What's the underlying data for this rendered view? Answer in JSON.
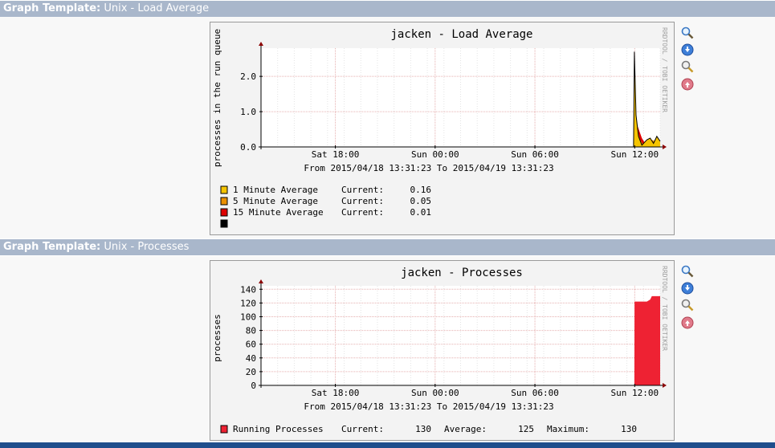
{
  "sections": [
    {
      "header_bold": "Graph Template:",
      "header_text": " Unix - Load Average",
      "graph": {
        "title": "jacken - Load Average",
        "side_text": "RRDTOOL / TOBI OETIKER",
        "date_range": "From 2015/04/18 13:31:23 To 2015/04/19 13:31:23",
        "legend": [
          {
            "label": "1 Minute Average",
            "current_label": "Current:",
            "current": "0.16",
            "color": "#f5c400"
          },
          {
            "label": "5 Minute Average",
            "current_label": "Current:",
            "current": "0.05",
            "color": "#ea8f00"
          },
          {
            "label": "15 Minute Average",
            "current_label": "Current:",
            "current": "0.01",
            "color": "#dd0000"
          },
          {
            "label": "",
            "current_label": "",
            "current": "",
            "color": "#000000"
          }
        ]
      }
    },
    {
      "header_bold": "Graph Template:",
      "header_text": " Unix - Processes",
      "graph": {
        "title": "jacken - Processes",
        "side_text": "RRDTOOL / TOBI OETIKER",
        "date_range": "From 2015/04/18 13:31:23 To 2015/04/19 13:31:23",
        "legend": [
          {
            "label": "Running Processes",
            "current_label": "Current:",
            "current": "130",
            "average_label": "Average:",
            "average": "125",
            "maximum_label": "Maximum:",
            "maximum": "130",
            "color": "#ee2233"
          }
        ]
      }
    }
  ],
  "icons": [
    "zoom-icon",
    "export-icon",
    "properties-icon",
    "move-up-icon"
  ],
  "chart_data": [
    {
      "type": "area",
      "title": "jacken - Load Average",
      "ylabel": "processes in the run queue",
      "xlabel": "",
      "x_tick_labels": [
        "Sat 18:00",
        "Sun 00:00",
        "Sun 06:00",
        "Sun 12:00"
      ],
      "y_tick_labels": [
        "0.0",
        "1.0",
        "2.0"
      ],
      "ylim": [
        0,
        2.8
      ],
      "xlim_hours_from_start": [
        0,
        24
      ],
      "grid": true,
      "series": [
        {
          "name": "15 Minute Average",
          "color": "#dd0000",
          "x": [
            22.4,
            22.45,
            22.6,
            22.9,
            23.1,
            23.4,
            23.6,
            23.8,
            24.0
          ],
          "values": [
            0,
            0.75,
            0.65,
            0.25,
            0.1,
            0.15,
            0.12,
            0.1,
            0.02
          ]
        },
        {
          "name": "5 Minute Average",
          "color": "#ea8f00",
          "x": [
            22.4,
            22.45,
            22.6,
            22.8,
            23.0,
            23.3,
            23.5,
            23.8,
            24.0
          ],
          "values": [
            0,
            0.7,
            0.55,
            0.2,
            0.05,
            0.1,
            0.2,
            0.15,
            0.05
          ]
        },
        {
          "name": "1 Minute Average",
          "color": "#f5c400",
          "x": [
            22.4,
            22.45,
            22.55,
            22.7,
            22.9,
            23.2,
            23.4,
            23.6,
            23.8,
            24.0
          ],
          "values": [
            0,
            2.7,
            0.9,
            0.3,
            0.05,
            0.2,
            0.25,
            0.1,
            0.3,
            0.16
          ]
        }
      ]
    },
    {
      "type": "area",
      "title": "jacken - Processes",
      "ylabel": "processes",
      "xlabel": "",
      "x_tick_labels": [
        "Sat 18:00",
        "Sun 00:00",
        "Sun 06:00",
        "Sun 12:00"
      ],
      "y_tick_labels": [
        "0",
        "20",
        "40",
        "60",
        "80",
        "100",
        "120",
        "140"
      ],
      "ylim": [
        0,
        145
      ],
      "xlim_hours_from_start": [
        0,
        24
      ],
      "grid": true,
      "series": [
        {
          "name": "Running Processes",
          "color": "#ee2233",
          "x": [
            22.45,
            22.46,
            23.2,
            23.4,
            23.5,
            24.0
          ],
          "values": [
            0,
            122,
            122,
            125,
            130,
            130
          ]
        }
      ]
    }
  ]
}
